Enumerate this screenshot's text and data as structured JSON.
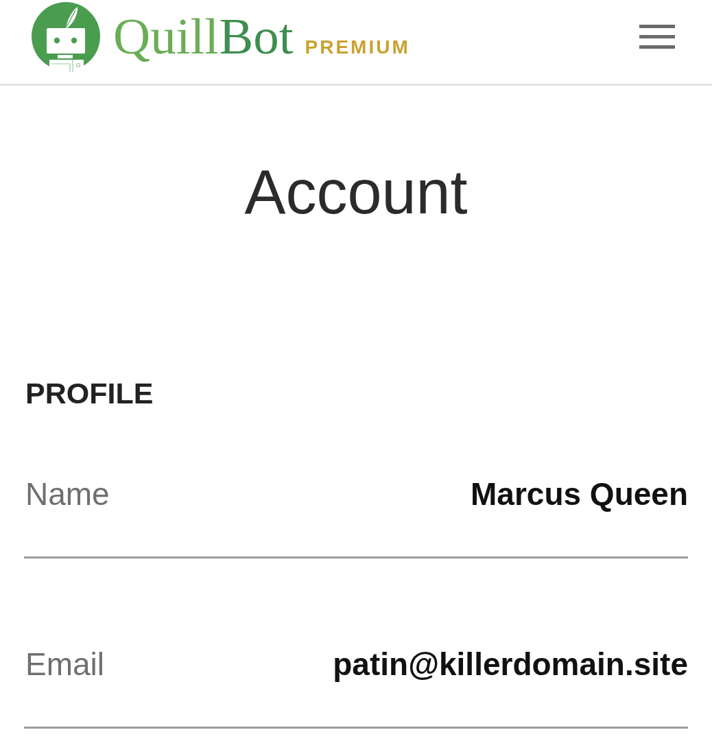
{
  "header": {
    "wordmark": "QuillBot",
    "plan_badge": "PREMIUM"
  },
  "page_title": "Account",
  "sections": [
    {
      "heading": "PROFILE",
      "fields": [
        {
          "label": "Name",
          "value": "Marcus Queen"
        },
        {
          "label": "Email",
          "value": "patin@killerdomain.site"
        }
      ]
    }
  ]
}
